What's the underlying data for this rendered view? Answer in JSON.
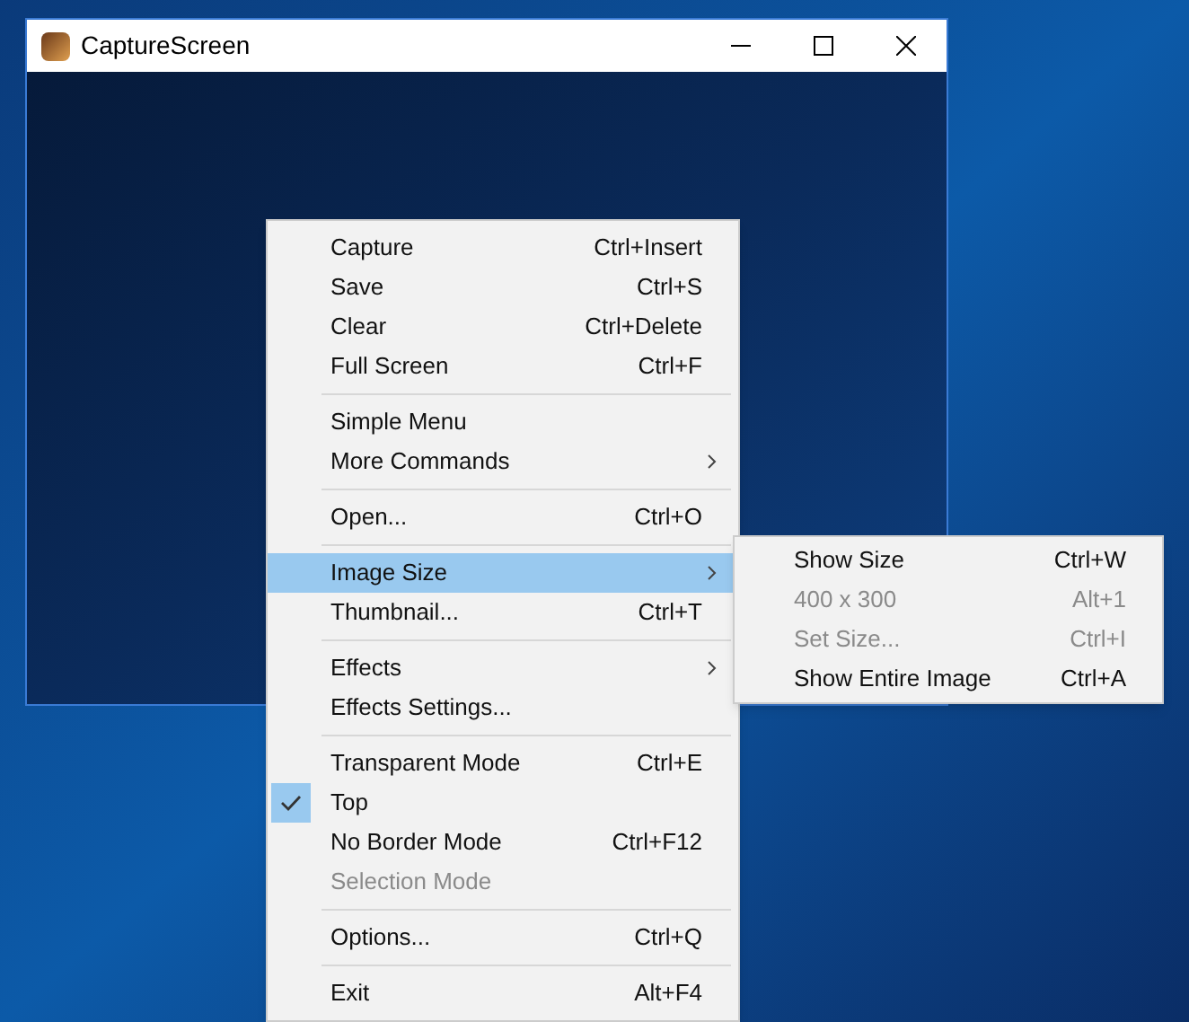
{
  "window": {
    "title": "CaptureScreen"
  },
  "menu": {
    "sections": [
      [
        {
          "label": "Capture",
          "shortcut": "Ctrl+Insert",
          "submenu": false,
          "disabled": false,
          "checked": false,
          "selected": false
        },
        {
          "label": "Save",
          "shortcut": "Ctrl+S",
          "submenu": false,
          "disabled": false,
          "checked": false,
          "selected": false
        },
        {
          "label": "Clear",
          "shortcut": "Ctrl+Delete",
          "submenu": false,
          "disabled": false,
          "checked": false,
          "selected": false
        },
        {
          "label": "Full Screen",
          "shortcut": "Ctrl+F",
          "submenu": false,
          "disabled": false,
          "checked": false,
          "selected": false
        }
      ],
      [
        {
          "label": "Simple Menu",
          "submenu": false,
          "disabled": false,
          "checked": false,
          "selected": false
        },
        {
          "label": "More Commands",
          "submenu": true,
          "disabled": false,
          "checked": false,
          "selected": false
        }
      ],
      [
        {
          "label": "Open...",
          "shortcut": "Ctrl+O",
          "submenu": false,
          "disabled": false,
          "checked": false,
          "selected": false
        }
      ],
      [
        {
          "label": "Image Size",
          "submenu": true,
          "disabled": false,
          "checked": false,
          "selected": true
        },
        {
          "label": "Thumbnail...",
          "shortcut": "Ctrl+T",
          "submenu": false,
          "disabled": false,
          "checked": false,
          "selected": false
        }
      ],
      [
        {
          "label": "Effects",
          "submenu": true,
          "disabled": false,
          "checked": false,
          "selected": false
        },
        {
          "label": "Effects Settings...",
          "submenu": false,
          "disabled": false,
          "checked": false,
          "selected": false
        }
      ],
      [
        {
          "label": "Transparent Mode",
          "shortcut": "Ctrl+E",
          "submenu": false,
          "disabled": false,
          "checked": false,
          "selected": false
        },
        {
          "label": "Top",
          "submenu": false,
          "disabled": false,
          "checked": true,
          "selected": false
        },
        {
          "label": "No Border Mode",
          "shortcut": "Ctrl+F12",
          "submenu": false,
          "disabled": false,
          "checked": false,
          "selected": false
        },
        {
          "label": "Selection Mode",
          "submenu": false,
          "disabled": true,
          "checked": false,
          "selected": false
        }
      ],
      [
        {
          "label": "Options...",
          "shortcut": "Ctrl+Q",
          "submenu": false,
          "disabled": false,
          "checked": false,
          "selected": false
        }
      ],
      [
        {
          "label": "Exit",
          "shortcut": "Alt+F4",
          "submenu": false,
          "disabled": false,
          "checked": false,
          "selected": false
        }
      ]
    ]
  },
  "submenu": {
    "items": [
      {
        "label": "Show Size",
        "shortcut": "Ctrl+W",
        "disabled": false
      },
      {
        "label": "400 x 300",
        "shortcut": "Alt+1",
        "disabled": true
      },
      {
        "label": "Set Size...",
        "shortcut": "Ctrl+I",
        "disabled": true
      },
      {
        "label": "Show Entire Image",
        "shortcut": "Ctrl+A",
        "disabled": false
      }
    ]
  }
}
